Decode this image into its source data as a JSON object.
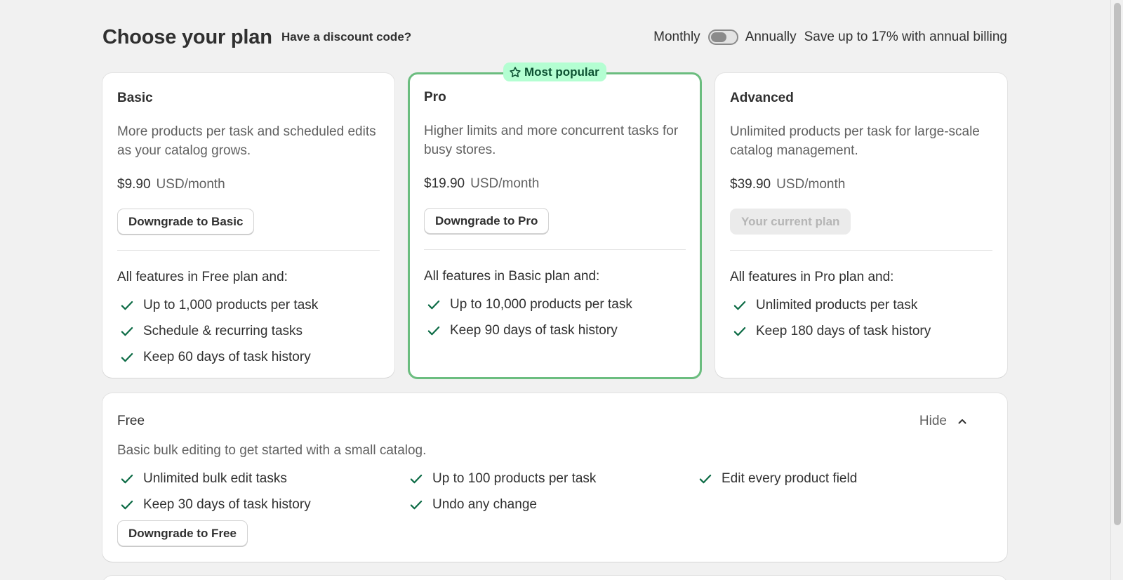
{
  "header": {
    "title": "Choose your plan",
    "discount_link": "Have a discount code?",
    "billing": {
      "monthly_label": "Monthly",
      "annually_label": "Annually",
      "annual_selected": false,
      "save_text": "Save up to 17% with annual billing"
    }
  },
  "plans": [
    {
      "name": "Basic",
      "description": "More products per task and scheduled edits as your catalog grows.",
      "price": "$9.90",
      "price_unit": "USD/month",
      "button_label": "Downgrade to Basic",
      "features_heading": "All features in Free plan and:",
      "features": [
        "Up to 1,000 products per task",
        "Schedule & recurring tasks",
        "Keep 60 days of task history"
      ]
    },
    {
      "name": "Pro",
      "badge": "Most popular",
      "badge_icon": "star-icon",
      "description": "Higher limits and more concurrent tasks for busy stores.",
      "price": "$19.90",
      "price_unit": "USD/month",
      "button_label": "Downgrade to Pro",
      "features_heading": "All features in Basic plan and:",
      "features": [
        "Up to 10,000 products per task",
        "Keep 90 days of task history"
      ]
    },
    {
      "name": "Advanced",
      "description": "Unlimited products per task for large-scale catalog management.",
      "price": "$39.90",
      "price_unit": "USD/month",
      "button_label": "Your current plan",
      "button_disabled": true,
      "features_heading": "All features in Pro plan and:",
      "features": [
        "Unlimited products per task",
        "Keep 180 days of task history"
      ]
    }
  ],
  "free_plan": {
    "name": "Free",
    "hide_label": "Hide",
    "description": "Basic bulk editing to get started with a small catalog.",
    "features": [
      "Unlimited bulk edit tasks",
      "Up to 100 products per task",
      "Edit every product field",
      "Keep 30 days of task history",
      "Undo any change"
    ],
    "button_label": "Downgrade to Free"
  },
  "colors": {
    "accent_check": "#0c6b45",
    "popular_border": "#6bbd7f",
    "popular_badge_bg": "#b4fed2"
  }
}
